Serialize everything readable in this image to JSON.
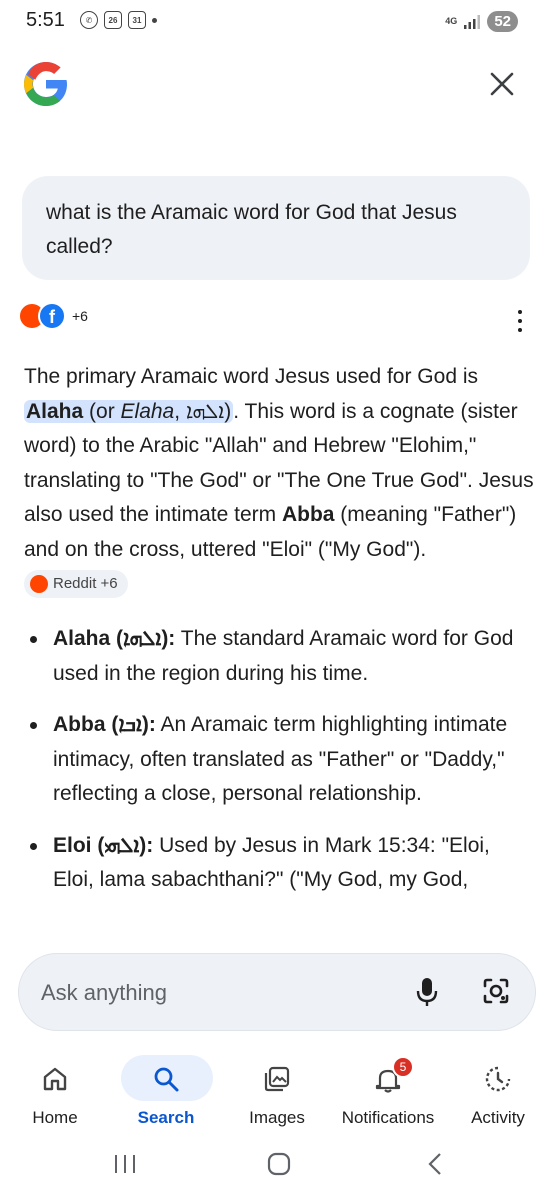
{
  "status_bar": {
    "time": "5:51",
    "network": "4G",
    "battery": "52",
    "notif_icons": [
      "whatsapp-icon",
      "calendar-26-icon",
      "calendar-31-icon"
    ],
    "notif_labels": [
      "26",
      "31"
    ]
  },
  "header": {
    "logo": "google-g-logo",
    "close_icon": "close-icon"
  },
  "query": {
    "text": "what is the Aramaic word for God that Jesus called?"
  },
  "sources": {
    "icons": [
      "reddit-icon",
      "facebook-icon"
    ],
    "more_count": "+6"
  },
  "answer": {
    "p1_start": "The primary Aramaic word Jesus used for God is ",
    "hl_bold": "Alaha",
    "hl_rest_a": " (or ",
    "hl_italic": "Elaha",
    "hl_rest_b": ", ܐܠܗܐ)",
    "p1_mid": ". This word is a cognate (sister word) to the Arabic \"Allah\" and Hebrew \"Elohim,\" translating to \"The God\" or \"The One True God\". Jesus also used the intimate term ",
    "abba_bold": "Abba",
    "p1_end": " (meaning \"Father\") and on the cross, uttered \"Eloi\" (\"My God\"). ",
    "chip_label": "Reddit +6"
  },
  "bullets": [
    {
      "term": "Alaha (ܐܠܗܐ):",
      "text": " The standard Aramaic word for God used in the region during his time."
    },
    {
      "term": "Abba (ܐܒܐ):",
      "text": " An Aramaic term highlighting intimate intimacy, often translated as \"Father\" or \"Daddy,\" reflecting a close, personal relationship."
    },
    {
      "term": "Eloi (ܐܠܗܝ):",
      "text": " Used by Jesus in Mark 15:34: \"Eloi, Eloi, lama sabachthani?\" (\"My God, my God,"
    }
  ],
  "ask": {
    "placeholder": "Ask anything"
  },
  "nav": {
    "items": [
      {
        "label": "Home",
        "icon": "home-icon"
      },
      {
        "label": "Search",
        "icon": "search-icon",
        "active": true
      },
      {
        "label": "Images",
        "icon": "images-icon"
      },
      {
        "label": "Notifications",
        "icon": "bell-icon",
        "badge": "5"
      },
      {
        "label": "Activity",
        "icon": "activity-icon"
      }
    ]
  },
  "colors": {
    "accent": "#0b57d0",
    "highlight": "#d3e3fd",
    "bubble": "#eef1f6",
    "badge": "#d93025"
  }
}
